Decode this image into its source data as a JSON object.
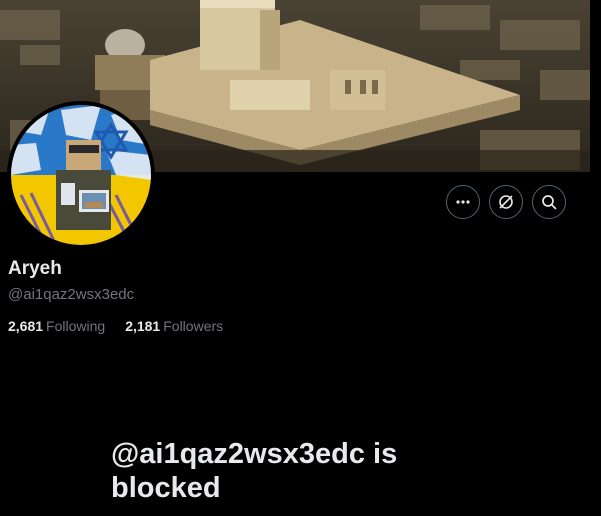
{
  "profile": {
    "name": "Aryeh",
    "handle": "@ai1qaz2wsx3edc",
    "following_count": "2,681",
    "following_label": "Following",
    "followers_count": "2,181",
    "followers_label": "Followers"
  },
  "actions": {
    "more_icon": "more-horizontal-icon",
    "grok_icon": "grok-icon",
    "search_icon": "search-icon"
  },
  "blocked_message": "@ai1qaz2wsx3edc is blocked",
  "colors": {
    "background": "#000000",
    "primary_text": "#e7e9ea",
    "secondary_text": "#71767b",
    "button_border": "#536471"
  }
}
